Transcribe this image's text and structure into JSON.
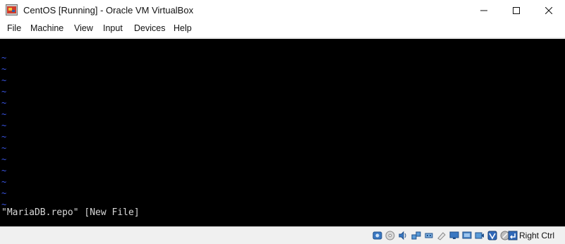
{
  "window": {
    "title": "CentOS [Running] - Oracle VM VirtualBox",
    "icon": "virtualbox-icon",
    "controls": [
      "minimize-icon",
      "maximize-icon",
      "close-icon"
    ]
  },
  "menu": {
    "items": [
      {
        "label": "File"
      },
      {
        "label": "Machine"
      },
      {
        "label": "View"
      },
      {
        "label": "Input"
      },
      {
        "label": "Devices"
      },
      {
        "label": "Help"
      }
    ]
  },
  "console": {
    "tildes": [
      "~",
      "~",
      "~",
      "~",
      "~",
      "~",
      "~",
      "~",
      "~",
      "~",
      "~",
      "~",
      "~",
      "~"
    ],
    "status_line": "\"MariaDB.repo\" [New File]",
    "tilde_color": "#3a55e6",
    "background": "#000000"
  },
  "statusbar": {
    "icons": [
      "hard-disk-icon",
      "optical-drive-icon",
      "audio-icon",
      "network-icon",
      "usb-icon",
      "shared-folders-icon",
      "display-icon",
      "video-capture-icon",
      "recording-icon",
      "virtualization-icon",
      "cpu-icon",
      "mouse-integration-icon"
    ],
    "host_key": "Right Ctrl"
  }
}
